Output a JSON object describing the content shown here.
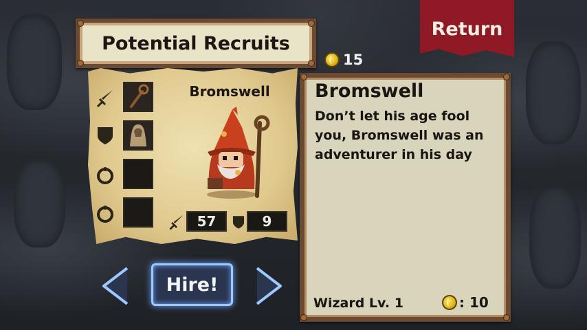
{
  "header": {
    "title": "Potential Recruits",
    "return_label": "Return"
  },
  "wallet": {
    "gold": "15",
    "icon": "gold-coin-icon"
  },
  "recruit_card": {
    "name": "Bromswell",
    "slots": [
      {
        "category": "weapon",
        "category_icon": "sword-icon",
        "item_icon": "wooden-staff-icon",
        "filled": true
      },
      {
        "category": "armor",
        "category_icon": "shield-icon",
        "item_icon": "cloth-robe-icon",
        "filled": true
      },
      {
        "category": "trinket",
        "category_icon": "ring-icon",
        "filled": false
      },
      {
        "category": "trinket",
        "category_icon": "ring-icon",
        "filled": false
      }
    ],
    "attack": "57",
    "defense": "9"
  },
  "actions": {
    "hire_label": "Hire!",
    "prev_icon": "chevron-left-icon",
    "next_icon": "chevron-right-icon"
  },
  "details": {
    "name": "Bromswell",
    "description": "Don’t let his age fool you, Bromswell was an adventurer in his day",
    "class_level": "Wizard Lv. 1",
    "cost": ": 10"
  },
  "colors": {
    "banner": "#8f1a25",
    "frame": "#6b4a34",
    "parchment": "#e0c98e",
    "hire_glow": "#9fc8ff"
  }
}
